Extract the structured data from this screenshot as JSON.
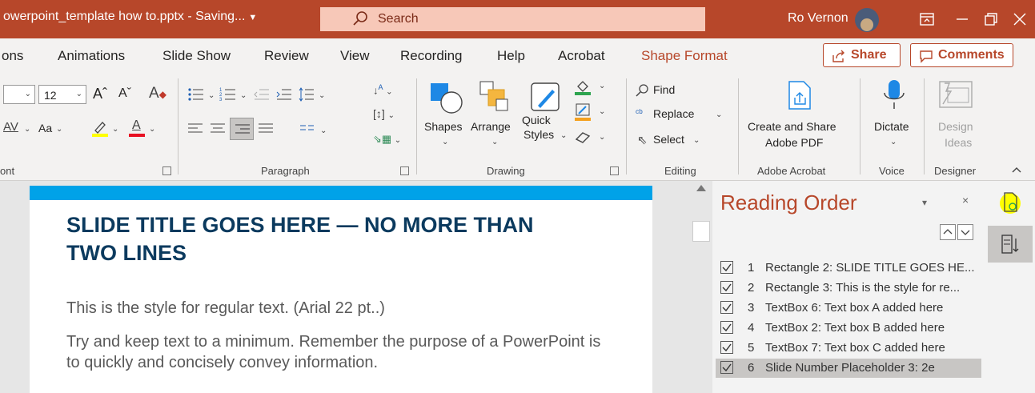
{
  "title_bar": {
    "doc_title": "owerpoint_template how to.pptx - Saving...",
    "search_label": "Search",
    "user_name": "Ro Vernon"
  },
  "tabs": [
    {
      "label": "ons"
    },
    {
      "label": "Animations"
    },
    {
      "label": "Slide Show"
    },
    {
      "label": "Review"
    },
    {
      "label": "View"
    },
    {
      "label": "Recording"
    },
    {
      "label": "Help"
    },
    {
      "label": "Acrobat"
    },
    {
      "label": "Shape Format"
    }
  ],
  "share": {
    "share_label": "Share",
    "comments_label": "Comments"
  },
  "ribbon": {
    "font": {
      "size": "12",
      "change_case": "Aa",
      "group_label": "ont"
    },
    "paragraph": {
      "group_label": "Paragraph"
    },
    "drawing": {
      "shapes": "Shapes",
      "arrange": "Arrange",
      "quick": "Quick",
      "styles": "Styles",
      "group_label": "Drawing"
    },
    "editing": {
      "find": "Find",
      "replace": "Replace",
      "select": "Select",
      "group_label": "Editing"
    },
    "acrobat": {
      "line1": "Create and Share",
      "line2": "Adobe PDF",
      "group_label": "Adobe Acrobat"
    },
    "voice": {
      "dictate": "Dictate",
      "group_label": "Voice"
    },
    "designer": {
      "line1": "Design",
      "line2": "Ideas",
      "group_label": "Designer"
    }
  },
  "slide": {
    "title": "SLIDE TITLE GOES HERE — NO MORE THAN TWO LINES",
    "body1": "This is the style for regular text. (Arial 22 pt..)",
    "body2": "Try and keep text to a minimum. Remember the purpose of a PowerPoint is to quickly and concisely convey information."
  },
  "reading_order": {
    "title": "Reading Order",
    "items": [
      {
        "num": "1",
        "text": "Rectangle 2: SLIDE TITLE GOES HE...",
        "checked": true,
        "selected": false
      },
      {
        "num": "2",
        "text": "Rectangle 3: This is the style for re...",
        "checked": true,
        "selected": false
      },
      {
        "num": "3",
        "text": "TextBox 6: Text box A added here",
        "checked": true,
        "selected": false
      },
      {
        "num": "4",
        "text": "TextBox 2:   Text box B added here",
        "checked": true,
        "selected": false
      },
      {
        "num": "5",
        "text": "TextBox 7: Text box C added here",
        "checked": true,
        "selected": false
      },
      {
        "num": "6",
        "text": "Slide Number Placeholder 3: 2e",
        "checked": true,
        "selected": true
      }
    ]
  },
  "colors": {
    "accent": "#b7472a",
    "slide_bar": "#00a2e8",
    "slide_title": "#0b3a5e",
    "highlight": "#ffff00"
  }
}
